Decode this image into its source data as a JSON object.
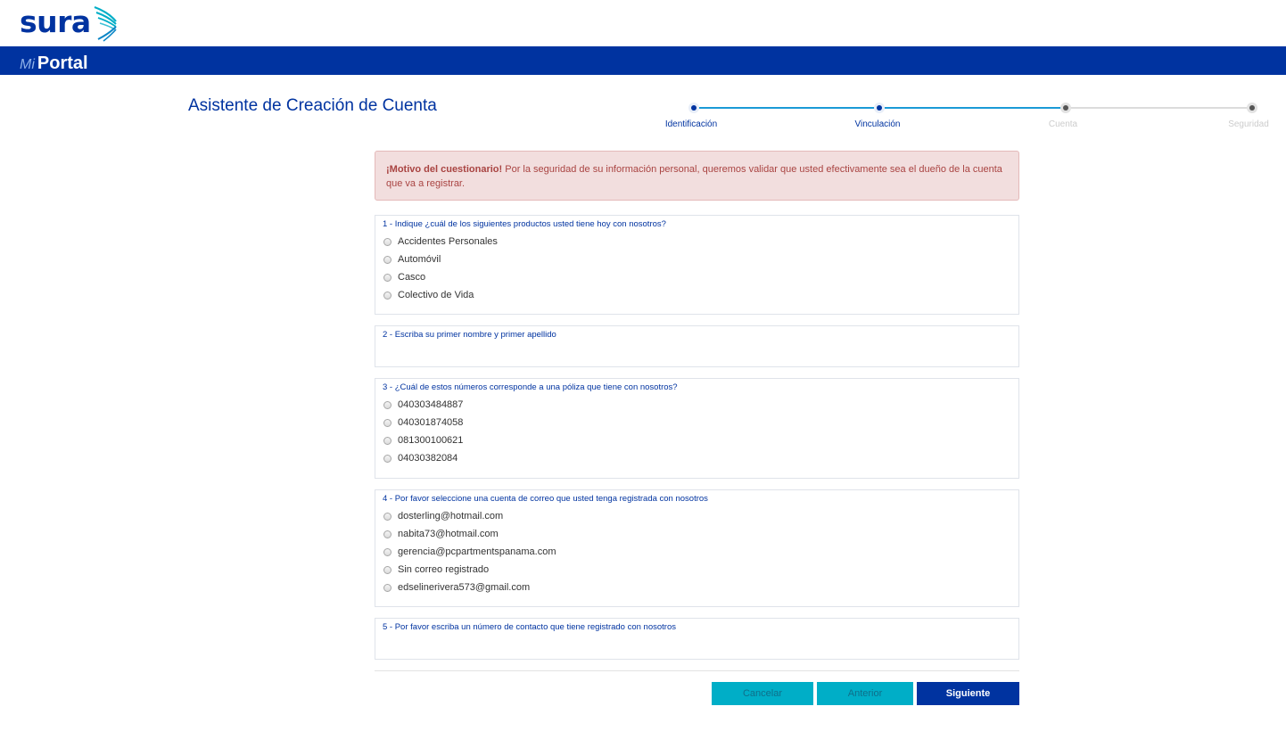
{
  "brand": {
    "logo_text": "sura",
    "mi": "Mi",
    "portal": "Portal"
  },
  "wizard": {
    "title": "Asistente de Creación de Cuenta",
    "steps": [
      {
        "label": "Identificación",
        "state": "active"
      },
      {
        "label": "Vinculación",
        "state": "active"
      },
      {
        "label": "Cuenta",
        "state": "inactive"
      },
      {
        "label": "Seguridad",
        "state": "inactive"
      }
    ]
  },
  "alert": {
    "bold": "¡Motivo del cuestionario!",
    "text": " Por la seguridad de su información personal, queremos validar que usted efectivamente sea el dueño de la cuenta que va a registrar."
  },
  "questions": [
    {
      "title": "1 - Indique ¿cuál de los siguientes productos usted tiene hoy con nosotros?",
      "options": [
        "Accidentes Personales",
        "Automóvil",
        "Casco",
        "Colectivo de Vida"
      ]
    },
    {
      "title": "2 - Escriba su primer nombre y primer apellido",
      "options": []
    },
    {
      "title": "3 - ¿Cuál de estos números corresponde a una póliza que tiene con nosotros?",
      "options": [
        "040303484887",
        "040301874058",
        "081300100621",
        "04030382084"
      ]
    },
    {
      "title": "4 - Por favor seleccione una cuenta de correo que usted tenga registrada con nosotros",
      "options": [
        "dosterling@hotmail.com",
        "nabita73@hotmail.com",
        "gerencia@pcpartmentspanama.com",
        "Sin correo registrado",
        "edselinerivera573@gmail.com"
      ]
    },
    {
      "title": "5 - Por favor escriba un número de contacto que tiene registrado con nosotros",
      "options": []
    }
  ],
  "buttons": {
    "cancel": "Cancelar",
    "previous": "Anterior",
    "next": "Siguiente"
  },
  "colors": {
    "brand_blue": "#0033a0",
    "accent_teal": "#00aec7",
    "alert_bg": "#f2dede",
    "alert_text": "#a94442"
  }
}
